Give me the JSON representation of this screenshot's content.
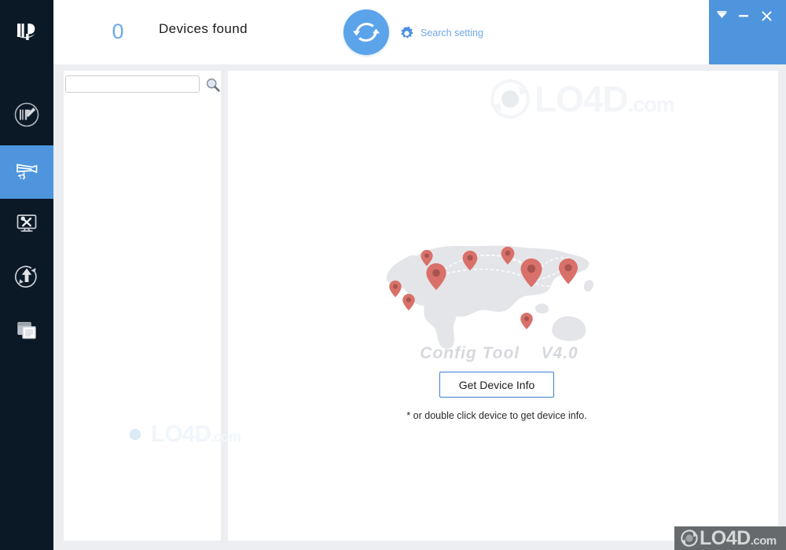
{
  "window": {
    "controls": [
      {
        "name": "collapse-button",
        "glyph": "collapse-icon",
        "title": "Collapse"
      },
      {
        "name": "minimize-button",
        "glyph": "minimize-icon",
        "title": "Minimize"
      },
      {
        "name": "close-button",
        "glyph": "close-icon",
        "title": "Close"
      }
    ],
    "accent_color": "#4e95de"
  },
  "brand": {
    "logo_icon": "company-logo-icon",
    "sidebar_color": "#0b1825"
  },
  "topbar": {
    "device_count": "0",
    "devices_found_label": "Devices found",
    "refresh_icon": "refresh-icon",
    "search_setting_label": "Search setting",
    "search_setting_icon": "gear-icon",
    "count_color": "#6aaaea",
    "link_color": "#6fa8e8"
  },
  "sidebar": {
    "items": [
      {
        "label": "IP Modify",
        "icon": "ip-edit-icon",
        "active": false
      },
      {
        "label": "Device Config",
        "icon": "camera-gear-icon",
        "active": true
      },
      {
        "label": "Device Tools",
        "icon": "monitor-tools-icon",
        "active": false
      },
      {
        "label": "Device Upgrade",
        "icon": "upgrade-arrow-icon",
        "active": false
      },
      {
        "label": "Device Logs",
        "icon": "documents-icon",
        "active": false
      }
    ],
    "active_color": "#4e95de"
  },
  "device_panel": {
    "search_placeholder": "",
    "search_value": "",
    "search_icon": "search-icon",
    "devices": []
  },
  "content": {
    "hero_title": "Config Tool    V4.0",
    "get_device_info_label": "Get Device Info",
    "hint_text": "* or double click device to get device info.",
    "map_icon": "world-map-graphic",
    "pin_color": "#d9706a",
    "button_border_color": "#3d7fd4"
  },
  "watermarks": {
    "brand": "LO4D",
    "suffix": ".com",
    "logo_icon": "lo4d-logo-icon",
    "badge_bg": "#666a6c"
  }
}
